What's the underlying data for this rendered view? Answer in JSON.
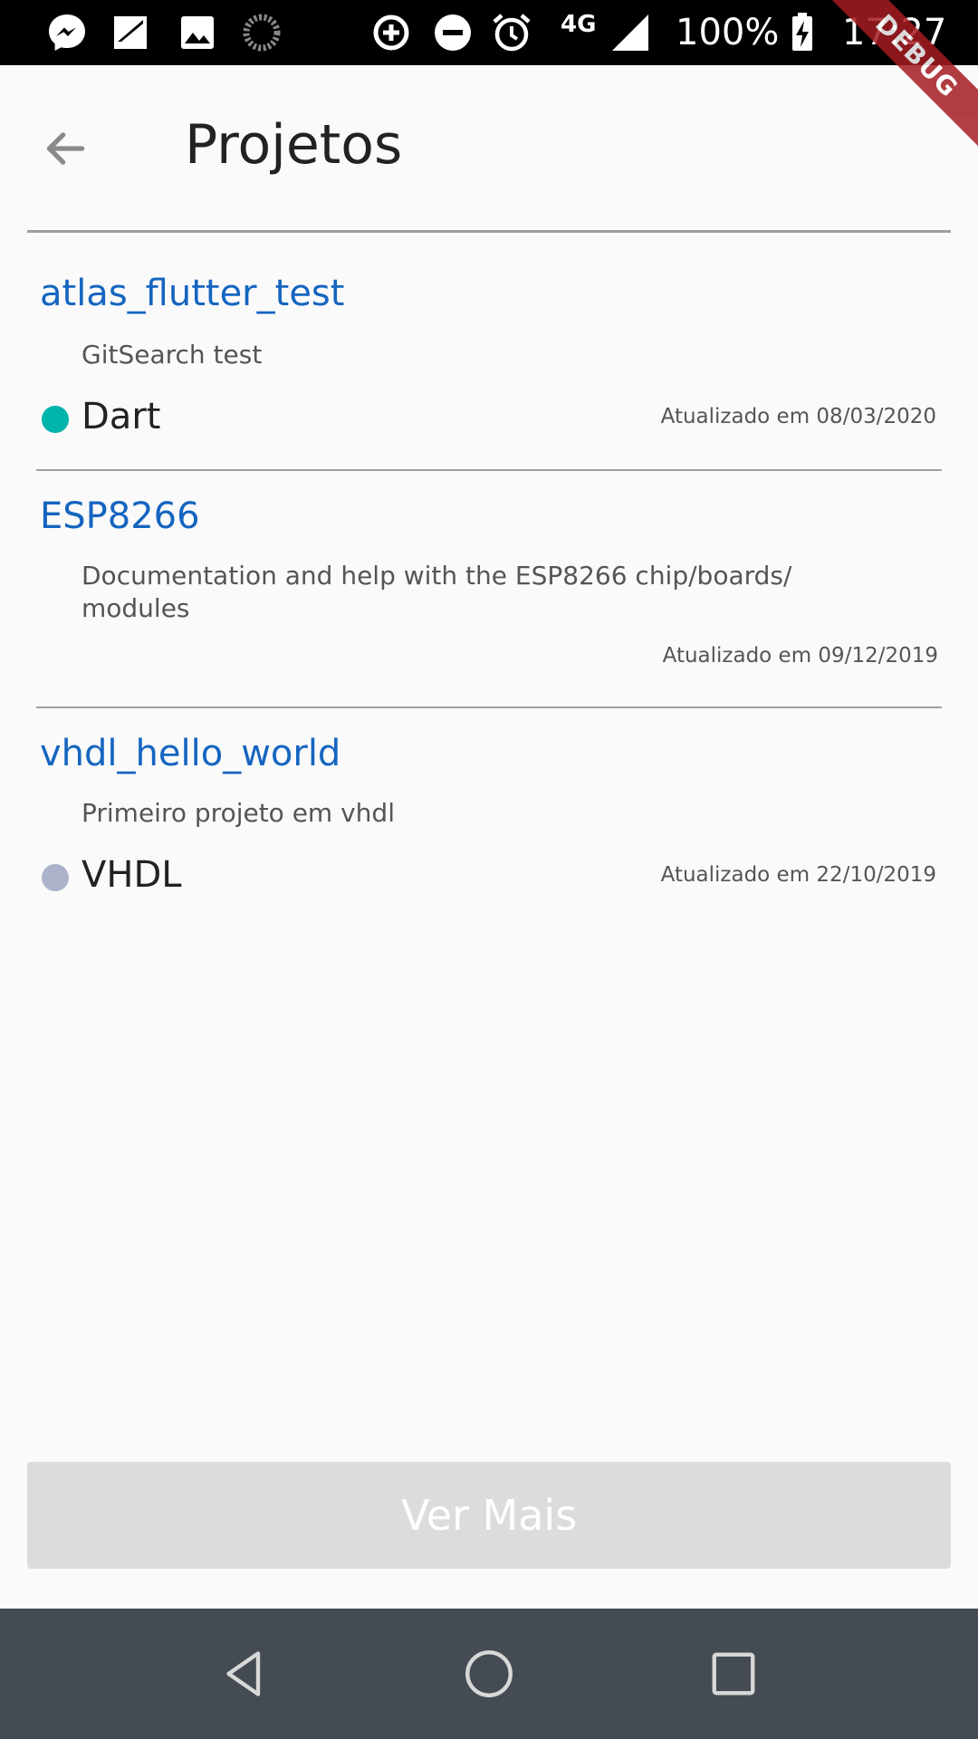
{
  "status_bar": {
    "network_type": "4G",
    "battery_percent": "100%",
    "time": "17:27",
    "icons": [
      "messenger-icon",
      "sim-card-icon",
      "image-icon",
      "sync-spinner-icon",
      "data-saver-icon",
      "do-not-disturb-icon",
      "alarm-icon",
      "signal-icon",
      "battery-charging-icon"
    ]
  },
  "debug_banner": "DEBUG",
  "header": {
    "title": "Projetos",
    "back_icon": "arrow-back-icon"
  },
  "repos": [
    {
      "name": "atlas_flutter_test",
      "description": "GitSearch test",
      "language": "Dart",
      "language_color": "#00b4ab",
      "updated": "Atualizado em 08/03/2020"
    },
    {
      "name": "ESP8266",
      "description": "Documentation and help with the ESP8266 chip/boards/ modules",
      "language": "",
      "language_color": "",
      "updated": "Atualizado em 09/12/2019"
    },
    {
      "name": "vhdl_hello_world",
      "description": "Primeiro projeto em vhdl",
      "language": "VHDL",
      "language_color": "#adb2cb",
      "updated": "Atualizado em 22/10/2019"
    }
  ],
  "footer": {
    "load_more_label": "Ver Mais"
  },
  "nav_bar": {
    "back": "nav-back-icon",
    "home": "nav-home-icon",
    "recents": "nav-recents-icon"
  },
  "colors": {
    "link": "#1565c0",
    "button_disabled": "#dcdcdc",
    "nav_bar": "#444b52"
  }
}
